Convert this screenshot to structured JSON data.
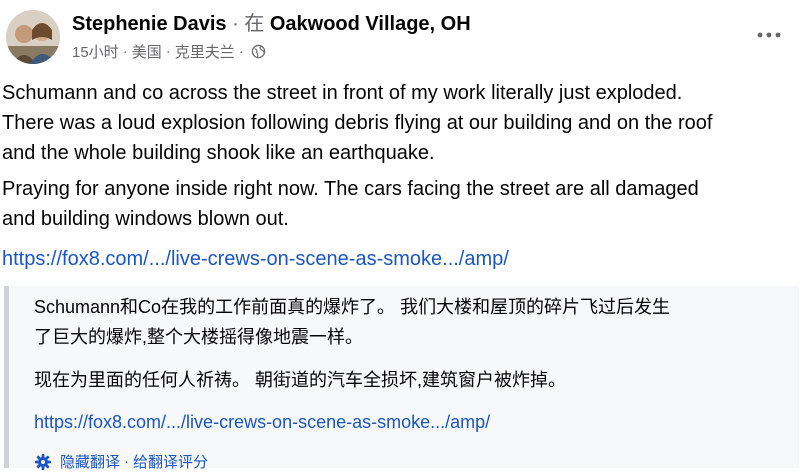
{
  "author": {
    "name": "Stephenie Davis",
    "connector": "· 在",
    "location": "Oakwood Village, OH"
  },
  "meta": {
    "time": "15小时",
    "country": "美国",
    "city": "克里夫兰"
  },
  "post": {
    "lines1": [
      "Schumann and co across the street in front of my work literally just exploded.",
      "There was a loud explosion following debris flying at our building and on the roof",
      "and the whole building shook like an earthquake."
    ],
    "lines2": [
      "Praying for anyone inside right now. The cars facing the street are all damaged",
      "and building windows blown out."
    ],
    "link": "https://fox8.com/.../live-crews-on-scene-as-smoke.../amp/"
  },
  "translation": {
    "lines1": [
      "Schumann和Co在我的工作前面真的爆炸了。 我们大楼和屋顶的碎片飞过后发生",
      "了巨大的爆炸,整个大楼摇得像地震一样。"
    ],
    "line2": "现在为里面的任何人祈祷。 朝街道的汽车全损坏,建筑窗户被炸掉。",
    "link": "https://fox8.com/.../live-crews-on-scene-as-smoke.../amp/",
    "hide_label": "隐藏翻译",
    "rate_label": "给翻译评分"
  },
  "colors": {
    "link": "#1a56c2",
    "meta": "#65676b",
    "translation_bg": "#f7f8fa"
  },
  "icons": {
    "avatar": "avatar-photo",
    "privacy": "globe-icon",
    "options": "more-icon",
    "translation_settings": "gear-icon"
  }
}
